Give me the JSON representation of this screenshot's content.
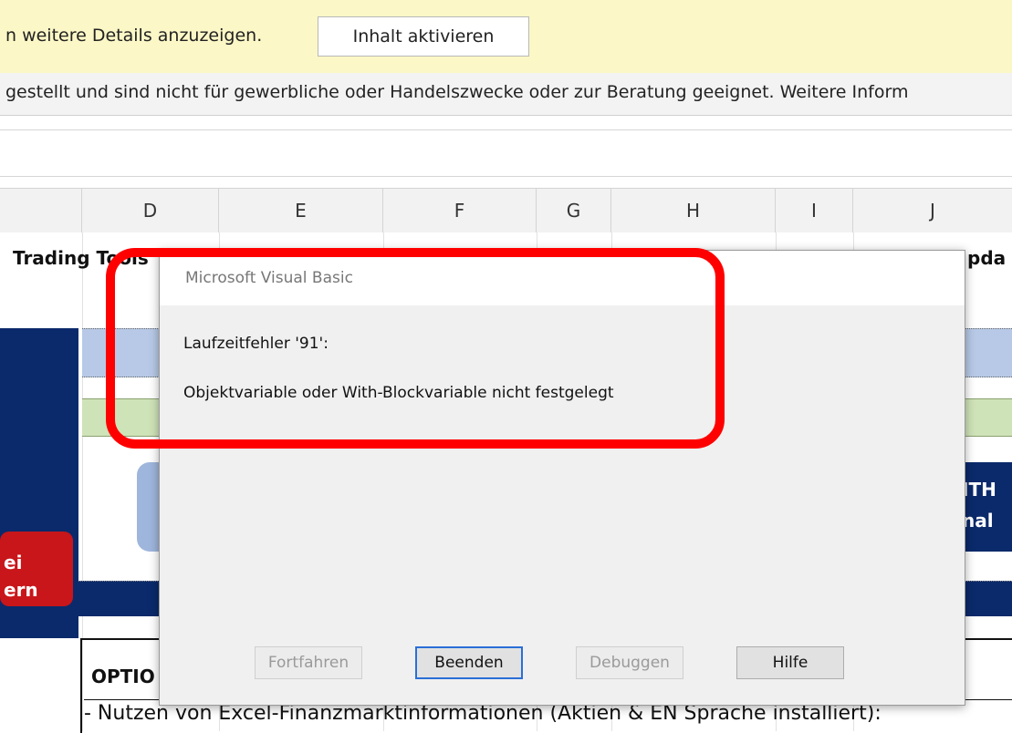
{
  "security_bar": {
    "message": "n weitere Details anzuzeigen.",
    "button_label": "Inhalt aktivieren"
  },
  "info_bar": {
    "message": "gestellt und sind nicht für gewerbliche oder Handelszwecke oder zur Beratung geeignet. Weitere Inform"
  },
  "columns": [
    "D",
    "E",
    "F",
    "G",
    "H",
    "I",
    "J"
  ],
  "sheet": {
    "trading_label": "Trading Tools",
    "right_header_fragment": "pda",
    "left_red_button": {
      "line1": "ei",
      "line2": "ern"
    },
    "right_blue_button": {
      "line1": "ITH",
      "line2": "nal"
    },
    "options_header": "OPTIO",
    "nutzen_text": "- Nutzen von Excel-Finanzmarktinformationen (Aktien & EN Sprache installiert):"
  },
  "dialog": {
    "title": "Microsoft Visual Basic",
    "error_line": "Laufzeitfehler '91':",
    "error_detail": "Objektvariable oder With-Blockvariable nicht festgelegt",
    "buttons": {
      "continue": "Fortfahren",
      "end": "Beenden",
      "debug": "Debuggen",
      "help": "Hilfe"
    }
  },
  "colors": {
    "highlight": "#ff0000",
    "security_bar": "#fbf7c6",
    "navy": "#0b2a6b"
  }
}
